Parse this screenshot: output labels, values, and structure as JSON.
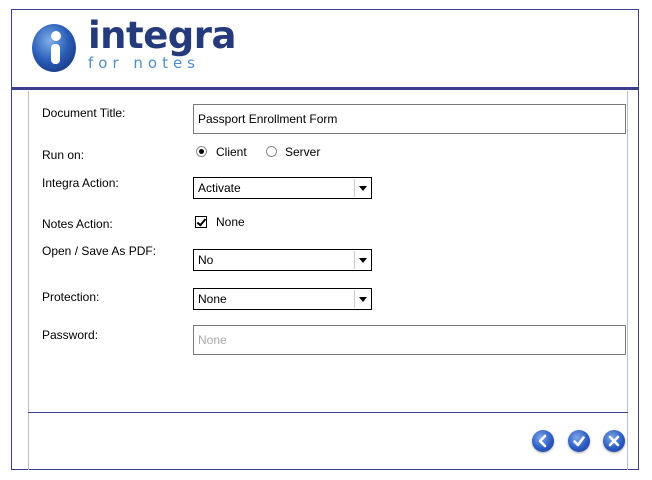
{
  "brand": {
    "name": "integra",
    "tagline": "for notes"
  },
  "form": {
    "document_title": {
      "label": "Document Title:",
      "value": "Passport Enrollment Form"
    },
    "run_on": {
      "label": "Run on:",
      "options": [
        {
          "label": "Client",
          "selected": true
        },
        {
          "label": "Server",
          "selected": false
        }
      ]
    },
    "integra_action": {
      "label": "Integra Action:",
      "value": "Activate"
    },
    "notes_action": {
      "label": "Notes Action:",
      "checkbox_label": "None",
      "checked": true
    },
    "open_save_pdf": {
      "label": "Open / Save As PDF:",
      "value": "No"
    },
    "protection": {
      "label": "Protection:",
      "value": "None"
    },
    "password": {
      "label": "Password:",
      "placeholder": "None"
    }
  },
  "footer": {
    "buttons": [
      {
        "icon": "back-arrow-icon"
      },
      {
        "icon": "checkmark-icon"
      },
      {
        "icon": "close-x-icon"
      }
    ]
  },
  "colors": {
    "frame": "#3c3f8c",
    "brand_dark": "#243a7a",
    "brand_light": "#4f8ec8",
    "button_blue": "#2b5cc4"
  }
}
